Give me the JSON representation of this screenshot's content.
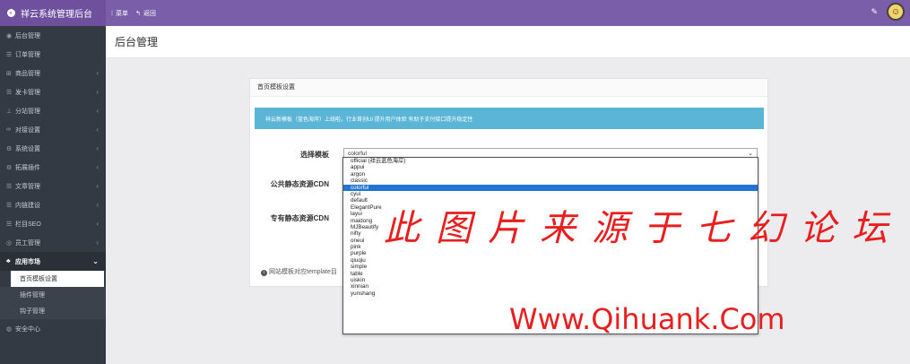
{
  "topbar": {
    "brand": "祥云系统管理后台",
    "nav": [
      {
        "label": "菜单",
        "icon": "menu-icon"
      },
      {
        "label": "返回",
        "icon": "back-icon"
      }
    ],
    "accent": "#7b5ea9"
  },
  "sidebar": {
    "items": [
      {
        "label": "后台管理",
        "icon": "dashboard-icon"
      },
      {
        "label": "订单管理",
        "icon": "list-icon"
      },
      {
        "label": "商品管理",
        "icon": "cart-icon"
      },
      {
        "label": "发卡管理",
        "icon": "card-icon"
      },
      {
        "label": "分站管理",
        "icon": "sitemap-icon"
      },
      {
        "label": "对接设置",
        "icon": "link-icon"
      },
      {
        "label": "系统设置",
        "icon": "gear-icon"
      },
      {
        "label": "拓展插件",
        "icon": "plugin-icon"
      },
      {
        "label": "文章管理",
        "icon": "article-icon"
      },
      {
        "label": "内链建设",
        "icon": "chain-icon"
      },
      {
        "label": "栏目SEO",
        "icon": "seo-icon"
      },
      {
        "label": "员工管理",
        "icon": "user-icon"
      },
      {
        "label": "应用市场",
        "icon": "app-icon"
      }
    ],
    "sub_items": [
      {
        "label": "首页模板设置"
      },
      {
        "label": "插件管理"
      },
      {
        "label": "钩子管理"
      }
    ],
    "bottom": {
      "label": "安全中心",
      "icon": "shield-icon"
    }
  },
  "main": {
    "page_title": "后台管理",
    "card_title": "首页模板设置",
    "alert": "祥云新模板（蓝色海岸）上线啦，行业首创UI 提升用户体验 有助于支付接口提升稳定性",
    "form": {
      "template_label": "选择模板",
      "template_value": "colorful",
      "public_cdn_label": "公共静态资源CDN",
      "private_cdn_label": "专有静态资源CDN"
    },
    "hint": "网站模板对应template目"
  },
  "dropdown": {
    "options": [
      "official (祥云蓝色海岸)",
      "appui",
      "argon",
      "classic",
      "colorful",
      "cyui",
      "default",
      "ElegantPure",
      "layui",
      "maidong",
      "MJBeautify",
      "nifty",
      "oneui",
      "pink",
      "purple",
      "qiuqiu",
      "simple",
      "table",
      "uiskin",
      "xinnian",
      "yunshang"
    ],
    "selected": "colorful"
  },
  "watermark": {
    "line1": "此图片来源于七幻论坛",
    "line2": "Www.Qihuank.Com"
  }
}
